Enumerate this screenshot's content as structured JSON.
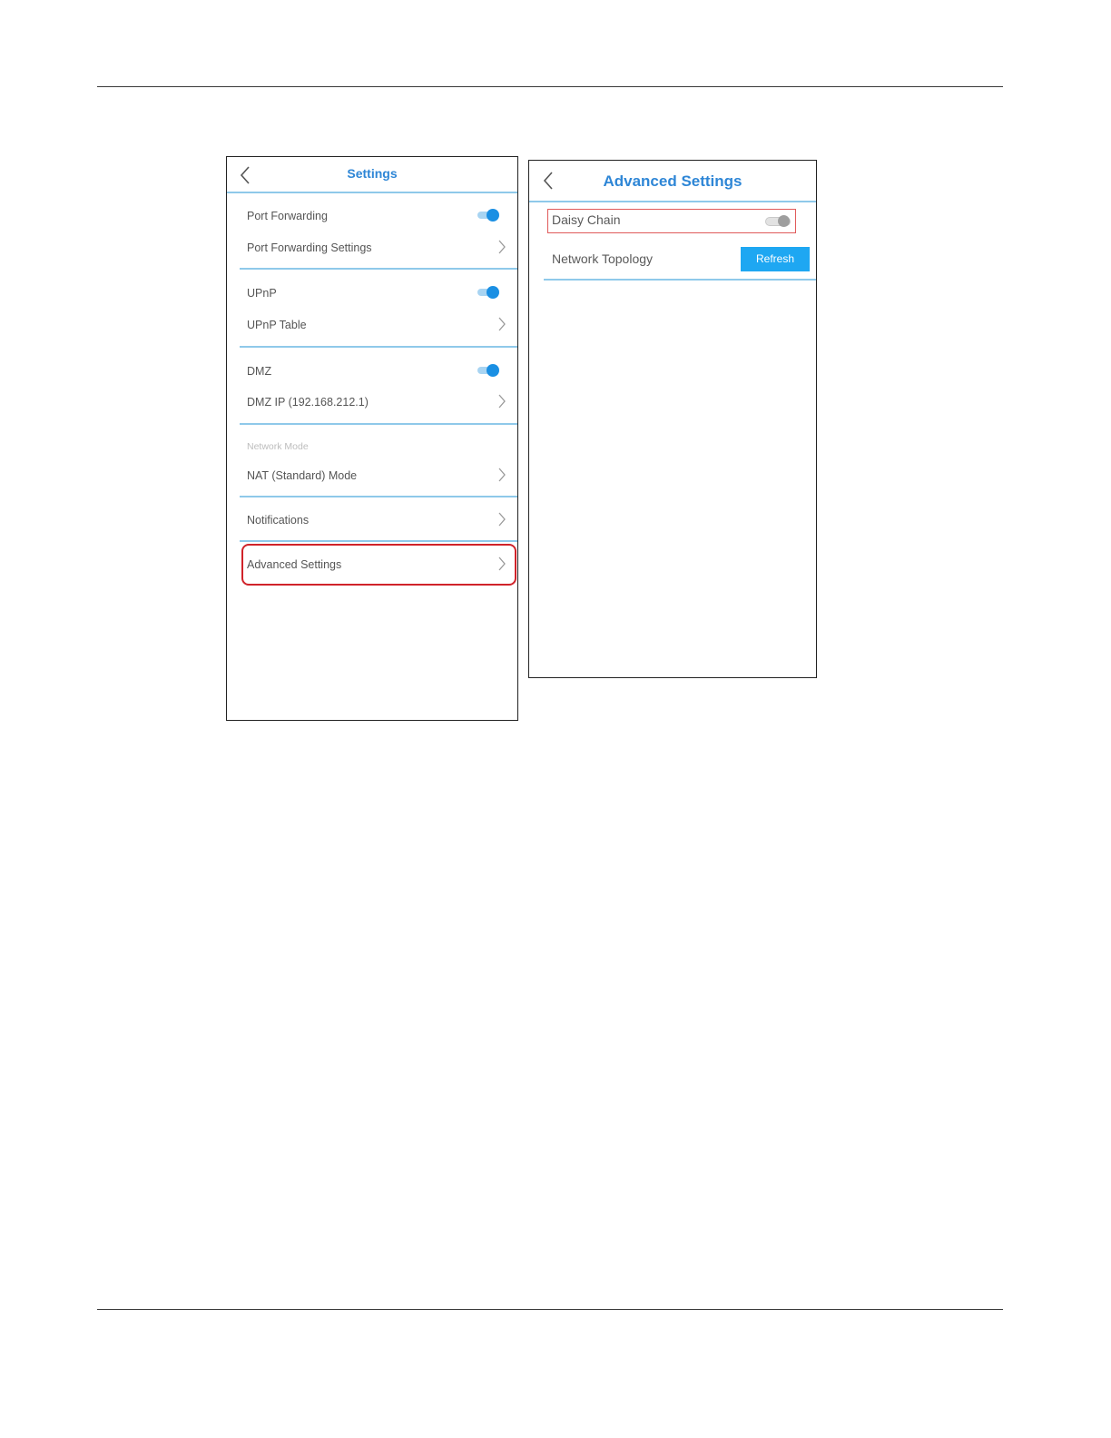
{
  "settings_screen": {
    "title": "Settings",
    "items": [
      {
        "label": "Port Forwarding",
        "control": "toggle-on"
      },
      {
        "label": "Port Forwarding Settings",
        "control": "chevron"
      },
      {
        "label": "UPnP",
        "control": "toggle-on"
      },
      {
        "label": "UPnP Table",
        "control": "chevron"
      },
      {
        "label": "DMZ",
        "control": "toggle-on"
      },
      {
        "label": "DMZ IP (192.168.212.1)",
        "control": "chevron"
      },
      {
        "label": "NAT (Standard) Mode",
        "control": "chevron"
      },
      {
        "label": "Notifications",
        "control": "chevron"
      },
      {
        "label": "Advanced Settings",
        "control": "chevron",
        "highlighted": true
      }
    ],
    "network_mode_label": "Network Mode"
  },
  "advanced_screen": {
    "title": "Advanced Settings",
    "daisy_chain_label": "Daisy Chain",
    "daisy_chain_enabled": false,
    "network_topology_label": "Network Topology",
    "refresh_label": "Refresh"
  },
  "colors": {
    "accent": "#2e86d6",
    "toggle_on": "#1a8fe3",
    "separator": "#8fc9ea",
    "highlight": "#d0232a",
    "refresh_button": "#1ea7f2"
  }
}
